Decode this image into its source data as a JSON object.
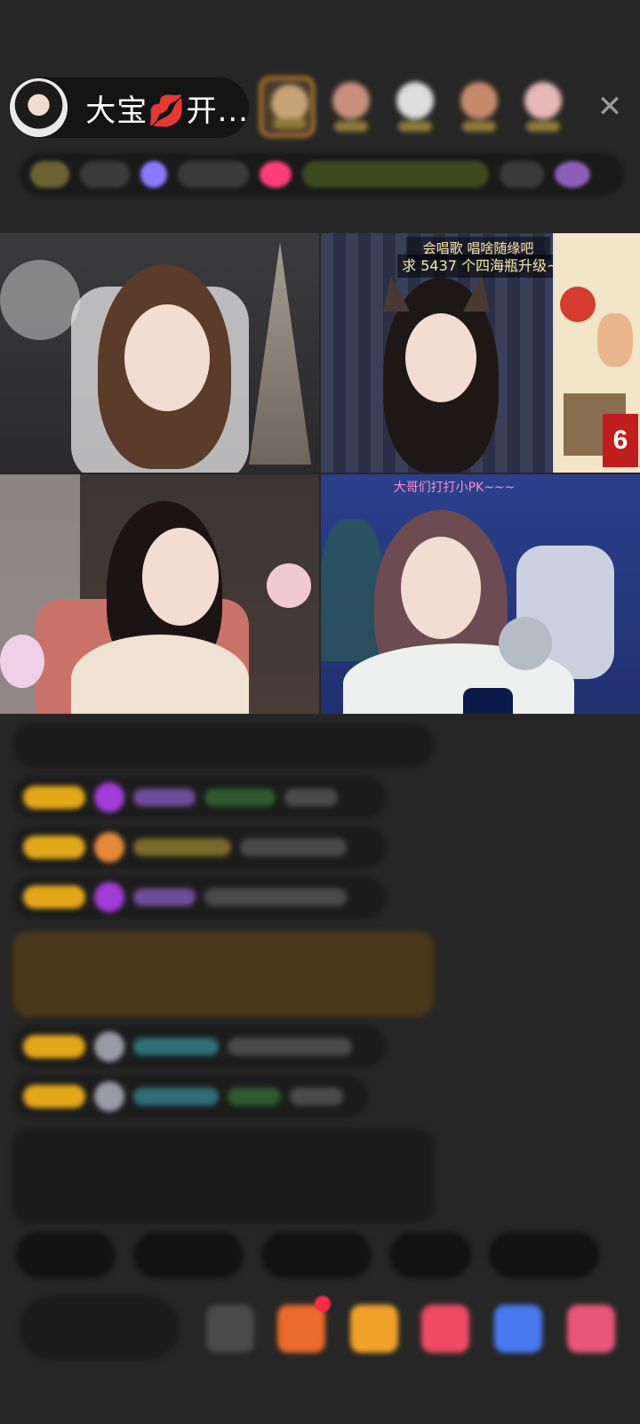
{
  "host": {
    "name": "大宝💋开..."
  },
  "top_right": {
    "close_icon": "close-icon"
  },
  "video_grid": {
    "tile2_line1": "会唱歌  唱啥随缘吧",
    "tile2_line2": "求 5437 个四海瓶升级~~",
    "tile2_poster_number": "6",
    "tile4_caption": "大哥们打打小PK~~~"
  },
  "colors": {
    "background": "#262626",
    "badge_gold": "#e3a71a",
    "caption_pink": "#ff8fd0",
    "caption_yellow": "#f7e8b0"
  }
}
